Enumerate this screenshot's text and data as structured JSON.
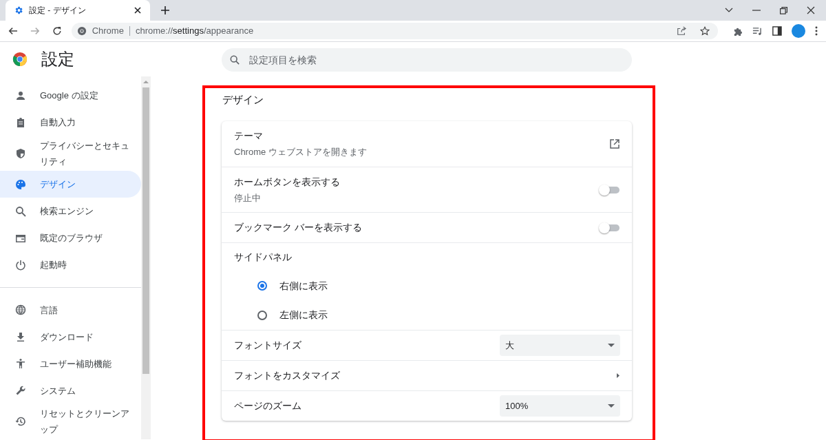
{
  "tab": {
    "title": "設定 - デザイン",
    "selected": true
  },
  "address": {
    "site": "Chrome",
    "url_prefix": "chrome://",
    "url_host": "settings",
    "url_path": "/appearance"
  },
  "header": {
    "title": "設定",
    "search_placeholder": "設定項目を検索"
  },
  "sidebar": {
    "sections": [
      {
        "items": [
          {
            "label": "Google の設定",
            "selected": false
          },
          {
            "label": "自動入力",
            "selected": false
          },
          {
            "label": "プライバシーとセキュリティ",
            "selected": false
          },
          {
            "label": "デザイン",
            "selected": true
          },
          {
            "label": "検索エンジン",
            "selected": false
          },
          {
            "label": "既定のブラウザ",
            "selected": false
          },
          {
            "label": "起動時",
            "selected": false
          }
        ]
      },
      {
        "items": [
          {
            "label": "言語",
            "selected": false
          },
          {
            "label": "ダウンロード",
            "selected": false
          },
          {
            "label": "ユーザー補助機能",
            "selected": false
          },
          {
            "label": "システム",
            "selected": false
          },
          {
            "label": "リセットとクリーンアップ",
            "selected": false
          }
        ]
      }
    ]
  },
  "section": {
    "title": "デザイン",
    "rows": [
      {
        "kind": "link",
        "label": "テーマ",
        "sublabel": "Chrome ウェブストアを開きます"
      },
      {
        "kind": "toggle",
        "label": "ホームボタンを表示する",
        "sublabel": "停止中",
        "on": false
      },
      {
        "kind": "toggle",
        "label": "ブックマーク バーを表示する",
        "on": false
      },
      {
        "kind": "heading",
        "label": "サイドパネル"
      },
      {
        "kind": "radio",
        "label": "右側に表示",
        "selected": true
      },
      {
        "kind": "radio",
        "label": "左側に表示",
        "selected": false
      },
      {
        "kind": "dropdown",
        "label": "フォントサイズ",
        "value": "大"
      },
      {
        "kind": "submenu",
        "label": "フォントをカスタマイズ"
      },
      {
        "kind": "dropdown",
        "label": "ページのズーム",
        "value": "100%"
      }
    ]
  }
}
